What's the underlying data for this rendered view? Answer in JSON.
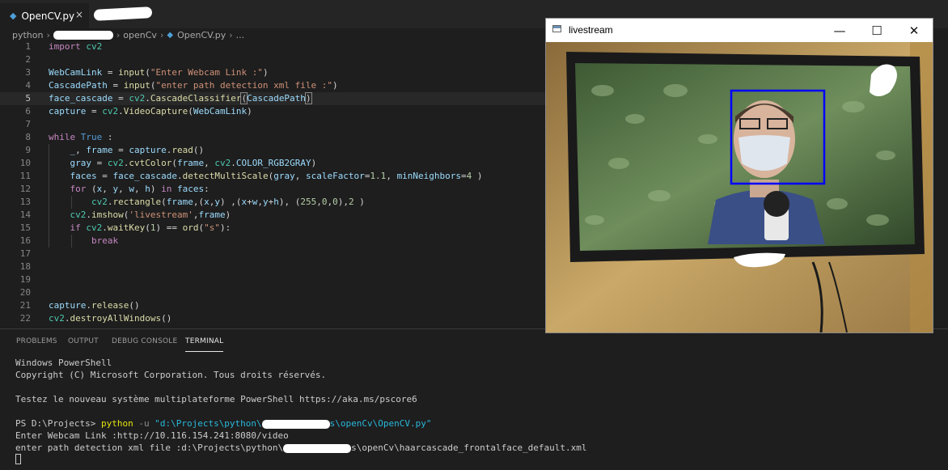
{
  "editor": {
    "tab": {
      "label": "OpenCV.py",
      "close": "×"
    },
    "breadcrumb": [
      "python",
      "openCv",
      "OpenCV.py",
      "..."
    ],
    "lines": [
      {
        "n": "1",
        "t": [
          [
            "k",
            "import"
          ],
          [
            "p",
            " "
          ],
          [
            "m",
            "cv2"
          ]
        ]
      },
      {
        "n": "2",
        "t": []
      },
      {
        "n": "3",
        "t": [
          [
            "v",
            "WebCamLink"
          ],
          [
            "p",
            " = "
          ],
          [
            "f",
            "input"
          ],
          [
            "p",
            "("
          ],
          [
            "s",
            "\"Enter Webcam Link :\""
          ],
          [
            "p",
            ")"
          ]
        ]
      },
      {
        "n": "4",
        "t": [
          [
            "v",
            "CascadePath"
          ],
          [
            "p",
            " = "
          ],
          [
            "f",
            "input"
          ],
          [
            "p",
            "("
          ],
          [
            "s",
            "\"enter path detection xml file :\""
          ],
          [
            "p",
            ")"
          ]
        ]
      },
      {
        "n": "5",
        "t": [
          [
            "v",
            "face_cascade"
          ],
          [
            "p",
            " = "
          ],
          [
            "m",
            "cv2"
          ],
          [
            "p",
            "."
          ],
          [
            "f",
            "CascadeClassifier"
          ],
          [
            "bm",
            "("
          ],
          [
            "v",
            "CascadePath"
          ],
          [
            "bm",
            ")"
          ]
        ]
      },
      {
        "n": "6",
        "t": [
          [
            "v",
            "capture"
          ],
          [
            "p",
            " = "
          ],
          [
            "m",
            "cv2"
          ],
          [
            "p",
            "."
          ],
          [
            "f",
            "VideoCapture"
          ],
          [
            "p",
            "("
          ],
          [
            "v",
            "WebCamLink"
          ],
          [
            "p",
            ")"
          ]
        ]
      },
      {
        "n": "7",
        "t": []
      },
      {
        "n": "8",
        "t": [
          [
            "k",
            "while"
          ],
          [
            "p",
            " "
          ],
          [
            "b",
            "True"
          ],
          [
            "p",
            " :"
          ]
        ]
      },
      {
        "n": "9",
        "t": [
          [
            "p",
            "    "
          ],
          [
            "v",
            "_"
          ],
          [
            "p",
            ", "
          ],
          [
            "v",
            "frame"
          ],
          [
            "p",
            " = "
          ],
          [
            "v",
            "capture"
          ],
          [
            "p",
            "."
          ],
          [
            "f",
            "read"
          ],
          [
            "p",
            "()"
          ]
        ]
      },
      {
        "n": "10",
        "t": [
          [
            "p",
            "    "
          ],
          [
            "v",
            "gray"
          ],
          [
            "p",
            " = "
          ],
          [
            "m",
            "cv2"
          ],
          [
            "p",
            "."
          ],
          [
            "f",
            "cvtColor"
          ],
          [
            "p",
            "("
          ],
          [
            "v",
            "frame"
          ],
          [
            "p",
            ", "
          ],
          [
            "m",
            "cv2"
          ],
          [
            "p",
            "."
          ],
          [
            "v",
            "COLOR_RGB2GRAY"
          ],
          [
            "p",
            ")"
          ]
        ]
      },
      {
        "n": "11",
        "t": [
          [
            "p",
            "    "
          ],
          [
            "v",
            "faces"
          ],
          [
            "p",
            " = "
          ],
          [
            "v",
            "face_cascade"
          ],
          [
            "p",
            "."
          ],
          [
            "f",
            "detectMultiScale"
          ],
          [
            "p",
            "("
          ],
          [
            "v",
            "gray"
          ],
          [
            "p",
            ", "
          ],
          [
            "v",
            "scaleFactor"
          ],
          [
            "p",
            "="
          ],
          [
            "n",
            "1.1"
          ],
          [
            "p",
            ", "
          ],
          [
            "v",
            "minNeighbors"
          ],
          [
            "p",
            "="
          ],
          [
            "n",
            "4"
          ],
          [
            "p",
            " )"
          ]
        ]
      },
      {
        "n": "12",
        "t": [
          [
            "p",
            "    "
          ],
          [
            "k",
            "for"
          ],
          [
            "p",
            " ("
          ],
          [
            "v",
            "x"
          ],
          [
            "p",
            ", "
          ],
          [
            "v",
            "y"
          ],
          [
            "p",
            ", "
          ],
          [
            "v",
            "w"
          ],
          [
            "p",
            ", "
          ],
          [
            "v",
            "h"
          ],
          [
            "p",
            ") "
          ],
          [
            "k",
            "in"
          ],
          [
            "p",
            " "
          ],
          [
            "v",
            "faces"
          ],
          [
            "p",
            ":"
          ]
        ]
      },
      {
        "n": "13",
        "t": [
          [
            "p",
            "        "
          ],
          [
            "m",
            "cv2"
          ],
          [
            "p",
            "."
          ],
          [
            "f",
            "rectangle"
          ],
          [
            "p",
            "("
          ],
          [
            "v",
            "frame"
          ],
          [
            "p",
            ",("
          ],
          [
            "v",
            "x"
          ],
          [
            "p",
            ","
          ],
          [
            "v",
            "y"
          ],
          [
            "p",
            ") ,("
          ],
          [
            "v",
            "x"
          ],
          [
            "p",
            "+"
          ],
          [
            "v",
            "w"
          ],
          [
            "p",
            ","
          ],
          [
            "v",
            "y"
          ],
          [
            "p",
            "+"
          ],
          [
            "v",
            "h"
          ],
          [
            "p",
            "), ("
          ],
          [
            "n",
            "255"
          ],
          [
            "p",
            ","
          ],
          [
            "n",
            "0"
          ],
          [
            "p",
            ","
          ],
          [
            "n",
            "0"
          ],
          [
            "p",
            "),"
          ],
          [
            "n",
            "2"
          ],
          [
            "p",
            " )"
          ]
        ]
      },
      {
        "n": "14",
        "t": [
          [
            "p",
            "    "
          ],
          [
            "m",
            "cv2"
          ],
          [
            "p",
            "."
          ],
          [
            "f",
            "imshow"
          ],
          [
            "p",
            "("
          ],
          [
            "s",
            "'livestream'"
          ],
          [
            "p",
            ","
          ],
          [
            "v",
            "frame"
          ],
          [
            "p",
            ")"
          ]
        ]
      },
      {
        "n": "15",
        "t": [
          [
            "p",
            "    "
          ],
          [
            "k",
            "if"
          ],
          [
            "p",
            " "
          ],
          [
            "m",
            "cv2"
          ],
          [
            "p",
            "."
          ],
          [
            "f",
            "waitKey"
          ],
          [
            "p",
            "("
          ],
          [
            "n",
            "1"
          ],
          [
            "p",
            ") == "
          ],
          [
            "f",
            "ord"
          ],
          [
            "p",
            "("
          ],
          [
            "s",
            "\"s\""
          ],
          [
            "p",
            "):"
          ]
        ]
      },
      {
        "n": "16",
        "t": [
          [
            "p",
            "        "
          ],
          [
            "k",
            "break"
          ]
        ]
      },
      {
        "n": "17",
        "t": []
      },
      {
        "n": "18",
        "t": []
      },
      {
        "n": "19",
        "t": []
      },
      {
        "n": "20",
        "t": []
      },
      {
        "n": "21",
        "t": [
          [
            "v",
            "capture"
          ],
          [
            "p",
            "."
          ],
          [
            "f",
            "release"
          ],
          [
            "p",
            "()"
          ]
        ]
      },
      {
        "n": "22",
        "t": [
          [
            "m",
            "cv2"
          ],
          [
            "p",
            "."
          ],
          [
            "f",
            "destroyAllWindows"
          ],
          [
            "p",
            "()"
          ]
        ]
      }
    ]
  },
  "panel": {
    "tabs": [
      "PROBLEMS",
      "OUTPUT",
      "DEBUG CONSOLE",
      "TERMINAL"
    ],
    "terminal": {
      "l1": "Windows PowerShell",
      "l2": "Copyright (C) Microsoft Corporation. Tous droits réservés.",
      "l3": "Testez le nouveau système multiplateforme PowerShell https://aka.ms/pscore6",
      "prompt": "PS D:\\Projects> ",
      "cmd": "python",
      "flag": " -u ",
      "path_a": "\"d:\\Projects\\python\\",
      "path_b": "s\\openCv\\OpenCV.py\"",
      "l5": "Enter Webcam Link :http://10.116.154.241:8080/video",
      "l6a": "enter path detection xml file :d:\\Projects\\python\\",
      "l6b": "s\\openCv\\haarcascade_frontalface_default.xml"
    }
  },
  "livestream": {
    "title": "livestream",
    "minimize": "—",
    "maximize": "☐",
    "close": "✕"
  },
  "colors": {
    "editor_bg": "#1e1e1e",
    "face_box": "#0000ff",
    "keyword": "#c586c0",
    "function": "#dcdcaa",
    "string": "#ce9178"
  }
}
